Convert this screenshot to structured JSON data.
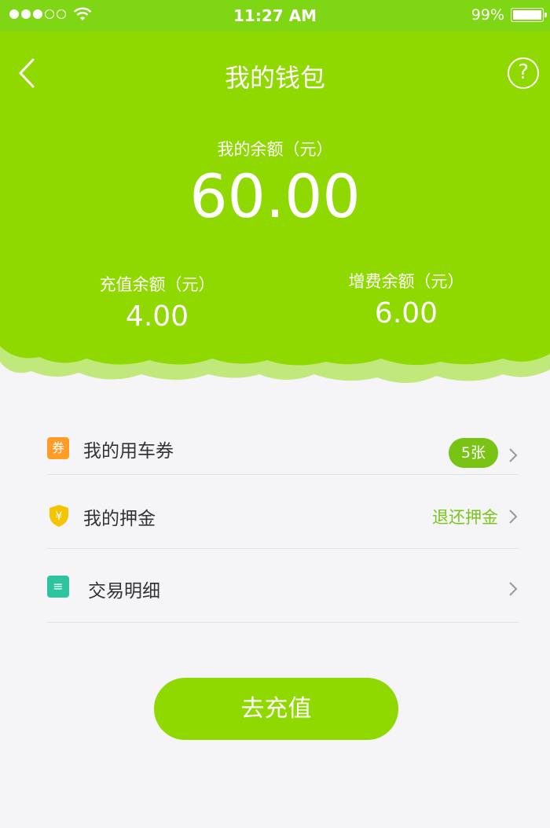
{
  "status": {
    "time": "11:27 AM",
    "battery": "99%",
    "signal_dots_filled": 3,
    "signal_dots_total": 5
  },
  "nav": {
    "title": "我的钱包",
    "help": "?",
    "back_icon": "chevron-left-icon"
  },
  "balance": {
    "label": "我的余额（元）",
    "value": "60.00"
  },
  "recharge_balance": {
    "label": "充值余额（元）",
    "value": "4.00"
  },
  "bonus_balance": {
    "label": "增费余额（元）",
    "value": "6.00"
  },
  "menu": {
    "coupons": {
      "icon": "券",
      "label": "我的用车券",
      "badge": "5张"
    },
    "deposit": {
      "icon": "¥",
      "label": "我的押金",
      "action": "退还押金"
    },
    "transactions": {
      "icon": "≡",
      "label": "交易明细"
    }
  },
  "cta": {
    "label": "去充值"
  },
  "colors": {
    "brand": "#8fd800",
    "status_bar": "#7fd615",
    "badge": "#78c314",
    "coupon_icon": "#ff9c27",
    "deposit_icon": "#f5c400",
    "transactions_icon": "#2fc4a0",
    "background": "#f5f5f8"
  }
}
